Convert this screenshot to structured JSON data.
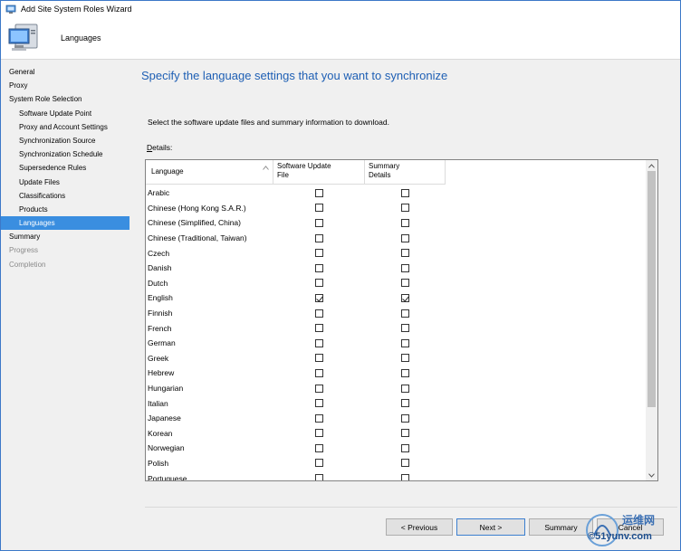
{
  "window": {
    "title": "Add Site System Roles Wizard"
  },
  "header": {
    "page_name": "Languages"
  },
  "sidebar": {
    "items": [
      {
        "label": "General",
        "level": 0,
        "state": "normal"
      },
      {
        "label": "Proxy",
        "level": 0,
        "state": "normal"
      },
      {
        "label": "System Role Selection",
        "level": 0,
        "state": "normal"
      },
      {
        "label": "Software Update Point",
        "level": 1,
        "state": "normal"
      },
      {
        "label": "Proxy and Account Settings",
        "level": 1,
        "state": "normal"
      },
      {
        "label": "Synchronization Source",
        "level": 1,
        "state": "normal"
      },
      {
        "label": "Synchronization Schedule",
        "level": 1,
        "state": "normal"
      },
      {
        "label": "Supersedence Rules",
        "level": 1,
        "state": "normal"
      },
      {
        "label": "Update Files",
        "level": 1,
        "state": "normal"
      },
      {
        "label": "Classifications",
        "level": 1,
        "state": "normal"
      },
      {
        "label": "Products",
        "level": 1,
        "state": "normal"
      },
      {
        "label": "Languages",
        "level": 1,
        "state": "active"
      },
      {
        "label": "Summary",
        "level": 0,
        "state": "normal"
      },
      {
        "label": "Progress",
        "level": 0,
        "state": "disabled"
      },
      {
        "label": "Completion",
        "level": 0,
        "state": "disabled"
      }
    ]
  },
  "main": {
    "heading": "Specify the language settings that you want to synchronize",
    "instructions": "Select the software update files and summary information to download.",
    "details_label": "Details:",
    "details_label_rest": "etails:",
    "details_label_accel": "D",
    "grid": {
      "columns": {
        "language": "Language",
        "software_update_file_line1": "Software Update",
        "software_update_file_line2": "File",
        "summary_details_line1": "Summary",
        "summary_details_line2": "Details"
      },
      "rows": [
        {
          "language": "Arabic",
          "software_update_file": false,
          "summary_details": false
        },
        {
          "language": "Chinese (Hong Kong S.A.R.)",
          "software_update_file": false,
          "summary_details": false
        },
        {
          "language": "Chinese (Simplified, China)",
          "software_update_file": false,
          "summary_details": false
        },
        {
          "language": "Chinese (Traditional, Taiwan)",
          "software_update_file": false,
          "summary_details": false
        },
        {
          "language": "Czech",
          "software_update_file": false,
          "summary_details": false
        },
        {
          "language": "Danish",
          "software_update_file": false,
          "summary_details": false
        },
        {
          "language": "Dutch",
          "software_update_file": false,
          "summary_details": false
        },
        {
          "language": "English",
          "software_update_file": true,
          "summary_details": true
        },
        {
          "language": "Finnish",
          "software_update_file": false,
          "summary_details": false
        },
        {
          "language": "French",
          "software_update_file": false,
          "summary_details": false
        },
        {
          "language": "German",
          "software_update_file": false,
          "summary_details": false
        },
        {
          "language": "Greek",
          "software_update_file": false,
          "summary_details": false
        },
        {
          "language": "Hebrew",
          "software_update_file": false,
          "summary_details": false
        },
        {
          "language": "Hungarian",
          "software_update_file": false,
          "summary_details": false
        },
        {
          "language": "Italian",
          "software_update_file": false,
          "summary_details": false
        },
        {
          "language": "Japanese",
          "software_update_file": false,
          "summary_details": false
        },
        {
          "language": "Korean",
          "software_update_file": false,
          "summary_details": false
        },
        {
          "language": "Norwegian",
          "software_update_file": false,
          "summary_details": false
        },
        {
          "language": "Polish",
          "software_update_file": false,
          "summary_details": false
        },
        {
          "language": "Portuguese",
          "software_update_file": false,
          "summary_details": false
        }
      ]
    }
  },
  "buttons": {
    "previous": "< Previous",
    "next": "Next >",
    "summary": "Summary",
    "cancel": "Cancel"
  },
  "watermark": {
    "line1": "运维网",
    "line2": "©51yunv.com"
  },
  "icons": {
    "app": "wizard-app-icon",
    "header": "computer-icon",
    "sort": "sort-ascending-icon",
    "scroll_up": "scroll-up-icon",
    "scroll_down": "scroll-down-icon"
  },
  "colors": {
    "heading": "#1e5fb4",
    "active_nav": "#3a8ee0",
    "panel": "#f0f0f0"
  }
}
